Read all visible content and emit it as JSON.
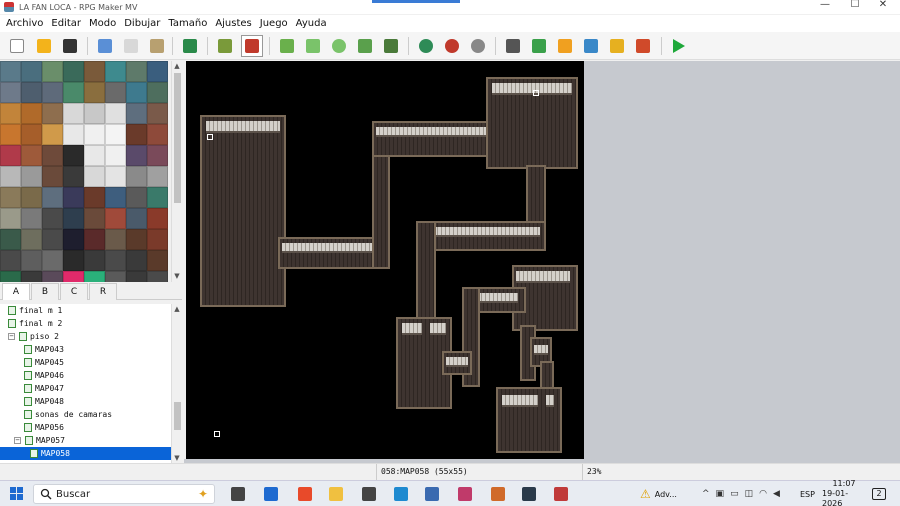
{
  "window": {
    "title": "LA FAN LOCA - RPG Maker MV",
    "controls": [
      "—",
      "☐",
      "✕"
    ]
  },
  "menu": [
    "Archivo",
    "Editar",
    "Modo",
    "Dibujar",
    "Tamaño",
    "Ajustes",
    "Juego",
    "Ayuda"
  ],
  "toolbar": [
    {
      "name": "new-project-icon",
      "color": "#ffffff"
    },
    {
      "name": "open-project-icon",
      "color": "#f3b31b"
    },
    {
      "name": "save-project-icon",
      "color": "#333333"
    },
    {
      "name": "cut-icon",
      "color": "#5a8fd6"
    },
    {
      "name": "copy-icon",
      "color": "#d8d8d8"
    },
    {
      "name": "paste-icon",
      "color": "#b8a070"
    },
    {
      "name": "undo-icon",
      "color": "#2a8a4a"
    },
    {
      "name": "map-mode-icon",
      "color": "#7a9a3a"
    },
    {
      "name": "event-mode-icon",
      "color": "#c0392b"
    },
    {
      "name": "pencil-icon",
      "color": "#6ab04c"
    },
    {
      "name": "rectangle-icon",
      "color": "#7ac36a"
    },
    {
      "name": "ellipse-icon",
      "color": "#7ac36a"
    },
    {
      "name": "flood-fill-icon",
      "color": "#5aa04c"
    },
    {
      "name": "shadow-pen-icon",
      "color": "#4a7a3a"
    },
    {
      "name": "zoom-in-icon",
      "color": "#2e8b57"
    },
    {
      "name": "zoom-out-icon",
      "color": "#c0392b"
    },
    {
      "name": "actual-size-icon",
      "color": "#888888"
    },
    {
      "name": "database-icon",
      "color": "#555555"
    },
    {
      "name": "plugin-manager-icon",
      "color": "#3aa04a"
    },
    {
      "name": "sound-test-icon",
      "color": "#f0a020"
    },
    {
      "name": "event-searcher-icon",
      "color": "#3a88c8"
    },
    {
      "name": "resource-manager-icon",
      "color": "#e6b020"
    },
    {
      "name": "character-generator-icon",
      "color": "#d04a2a"
    },
    {
      "name": "playtest-icon",
      "color": "#1ea83a"
    }
  ],
  "tileset_tabs": [
    "A",
    "B",
    "C",
    "R"
  ],
  "tileset_colors": [
    "#5a7a8a",
    "#4a6e7e",
    "#6a8e6a",
    "#3a6a5a",
    "#7a5a3a",
    "#3e8a8e",
    "#5e7a6a",
    "#3a5e7e",
    "#6e7a8a",
    "#4e5e6e",
    "#5e6a7a",
    "#4a8a6a",
    "#8a6e3e",
    "#6a6a6a",
    "#3e7a8e",
    "#4e6e5e",
    "#c2843a",
    "#b06a2a",
    "#8e6e4e",
    "#d8d8d8",
    "#c8c8c8",
    "#e0e0e0",
    "#5e6e7e",
    "#7a5a4a",
    "#c8762e",
    "#a65e2a",
    "#d09a4a",
    "#e8e8e8",
    "#f0f0f0",
    "#f4f4f4",
    "#6a3a2a",
    "#8e4a3a",
    "#b03a4a",
    "#9e5a3a",
    "#6e4a3a",
    "#2a2a2a",
    "#e8e8e8",
    "#f0f0f0",
    "#5a4a6a",
    "#7a4a5a",
    "#b8b8b8",
    "#9a9a9a",
    "#6a4a3a",
    "#3a3a3a",
    "#d8d8d8",
    "#e4e4e4",
    "#8a8a8a",
    "#a0a0a0",
    "#8a7a5a",
    "#7a6a4a",
    "#5e6e7e",
    "#3a3a5a",
    "#6a3a2a",
    "#3e5e7e",
    "#5a5a5a",
    "#3a7a6a",
    "#9a9a8a",
    "#7a7a7a",
    "#4a4a4a",
    "#2e3e4e",
    "#6a4a3a",
    "#a04a3a",
    "#4a5a6a",
    "#8a3a2a",
    "#3a5a4a",
    "#6e6e5e",
    "#4a4a4a",
    "#1e1e2e",
    "#5a2a2a",
    "#6a5a4a",
    "#5a3a2a",
    "#7a3a2a",
    "#4a4a4a",
    "#5e5e5e",
    "#6a6a6a",
    "#2a2a2a",
    "#3a3a3a",
    "#4a4a4a",
    "#3a3a3a",
    "#5a3a2a",
    "#2a6a4a",
    "#3a3a3a",
    "#5a4a5a",
    "#e02a6a",
    "#2ab07a",
    "#5a5a5a",
    "#3a3a3a",
    "#4a4a4a"
  ],
  "map_tree": [
    {
      "label": "final m 1",
      "indent": 1,
      "expander": "",
      "selected": false
    },
    {
      "label": "final m 2",
      "indent": 1,
      "expander": "",
      "selected": false
    },
    {
      "label": "piso 2",
      "indent": 1,
      "expander": "−",
      "selected": false
    },
    {
      "label": "MAP043",
      "indent": 2,
      "expander": "",
      "selected": false
    },
    {
      "label": "MAP045",
      "indent": 2,
      "expander": "",
      "selected": false
    },
    {
      "label": "MAP046",
      "indent": 2,
      "expander": "",
      "selected": false
    },
    {
      "label": "MAP047",
      "indent": 2,
      "expander": "",
      "selected": false
    },
    {
      "label": "MAP048",
      "indent": 2,
      "expander": "",
      "selected": false
    },
    {
      "label": "sonas de camaras",
      "indent": 2,
      "expander": "",
      "selected": false
    },
    {
      "label": "MAP056",
      "indent": 2,
      "expander": "",
      "selected": false
    },
    {
      "label": "MAP057",
      "indent": 2,
      "expander": "−",
      "selected": false
    },
    {
      "label": "MAP058",
      "indent": 3,
      "expander": "",
      "selected": true
    }
  ],
  "status": {
    "map": "058:MAP058 (55x55)",
    "zoom": "23%"
  },
  "taskbar": {
    "search_label": "Buscar",
    "apps": [
      {
        "name": "task-view-icon",
        "color": "#444444"
      },
      {
        "name": "media-player-icon",
        "color": "#1e6ad0"
      },
      {
        "name": "brave-browser-icon",
        "color": "#e84a2a"
      },
      {
        "name": "file-explorer-icon",
        "color": "#f0c040"
      },
      {
        "name": "settings-icon",
        "color": "#444444"
      },
      {
        "name": "mail-icon",
        "color": "#1e8ad0"
      },
      {
        "name": "photos-icon",
        "color": "#3a6ab0"
      },
      {
        "name": "video-player-icon",
        "color": "#c03a6a"
      },
      {
        "name": "rpg-maker-store-icon",
        "color": "#d06a2a"
      },
      {
        "name": "steam-icon",
        "color": "#2a3a4a"
      },
      {
        "name": "rpg-maker-mv-icon",
        "color": "#c03a3a"
      }
    ],
    "warning_label": "Adv...",
    "language": "ESP",
    "time": "11:07",
    "date": "19-01-2026",
    "notification_count": "2"
  }
}
